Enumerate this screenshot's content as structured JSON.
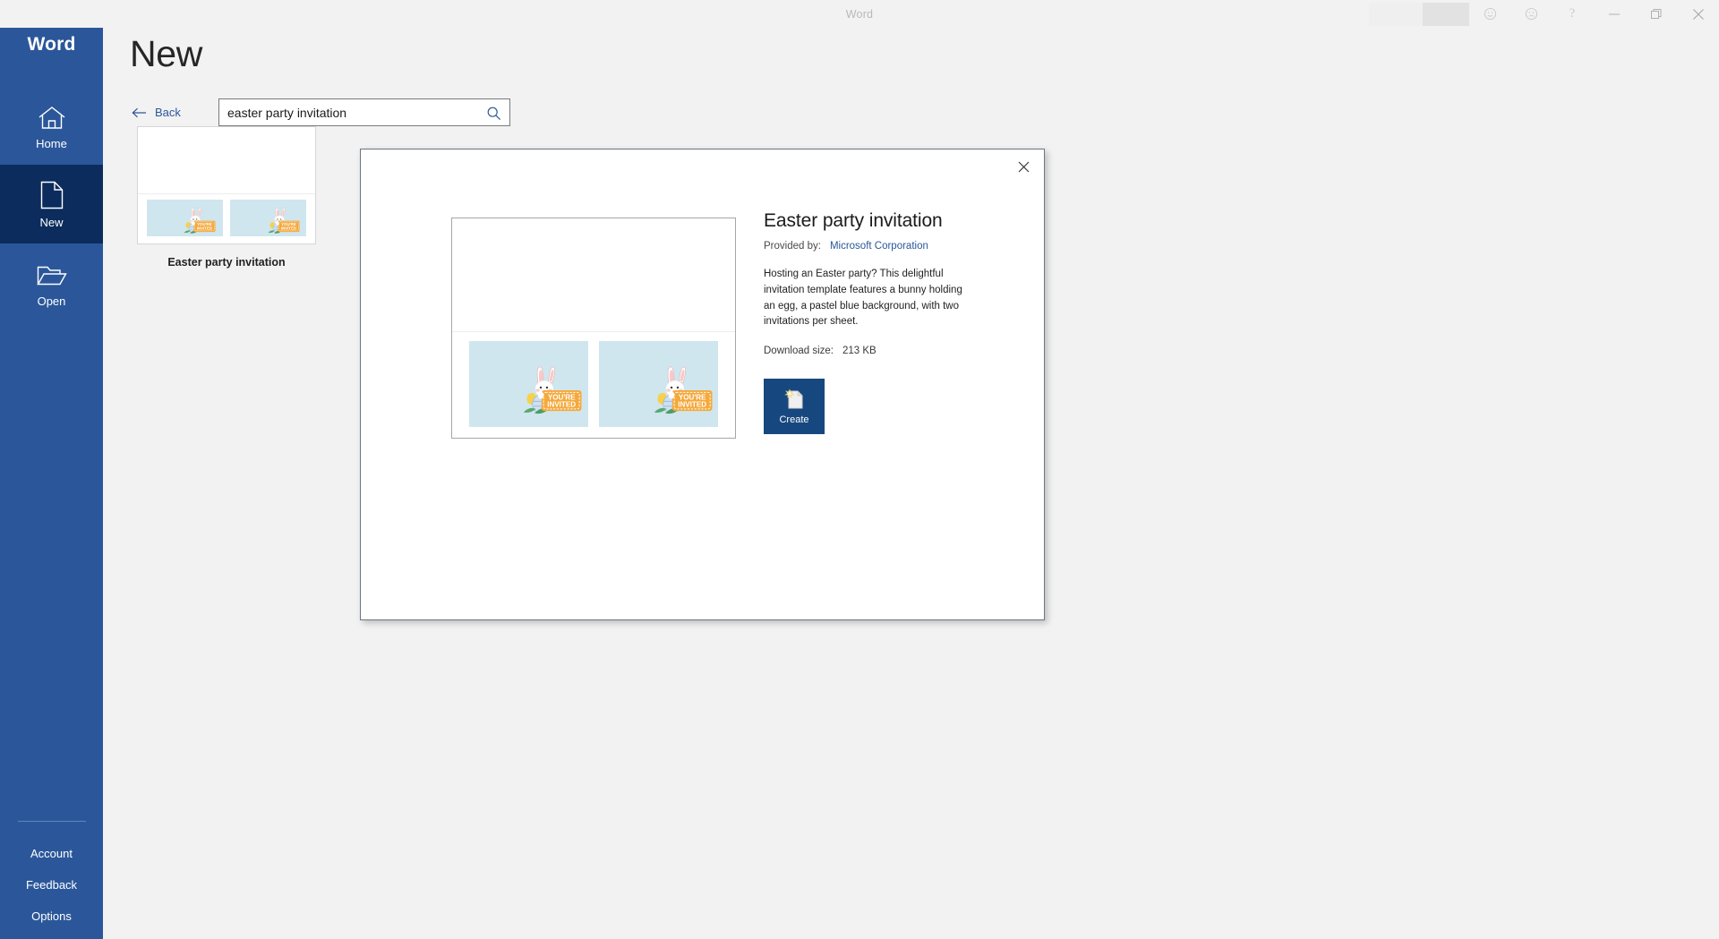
{
  "window": {
    "title": "Word",
    "controls": {
      "smile_icon": "smiley-face-icon",
      "frown_icon": "frowning-face-icon",
      "help_label": "?",
      "minimize_label": "minimize-icon",
      "restore_label": "restore-icon",
      "close_label": "close-icon"
    }
  },
  "sidebar": {
    "brand": "Word",
    "items": [
      {
        "label": "Home",
        "icon": "home-icon",
        "selected": false
      },
      {
        "label": "New",
        "icon": "new-document-icon",
        "selected": true
      },
      {
        "label": "Open",
        "icon": "open-folder-icon",
        "selected": false
      }
    ],
    "bottom_links": [
      {
        "label": "Account"
      },
      {
        "label": "Feedback"
      },
      {
        "label": "Options"
      }
    ]
  },
  "main": {
    "page_title": "New",
    "back_label": "Back",
    "back_icon": "left-arrow-icon",
    "search": {
      "value": "easter party invitation",
      "placeholder": "Search for online templates",
      "icon": "search-icon"
    },
    "results": [
      {
        "caption": "Easter party invitation"
      }
    ]
  },
  "modal": {
    "close_icon": "close-icon",
    "title": "Easter party invitation",
    "provided_by_label": "Provided by:",
    "provided_by_value": "Microsoft Corporation",
    "description": "Hosting an Easter party? This delightful invitation template features a bunny holding an egg, a pastel blue background, with two invitations per sheet.",
    "download_size_label": "Download size:",
    "download_size_value": "213 KB",
    "create_label": "Create",
    "create_icon": "new-document-icon"
  },
  "artwork": {
    "card_text_line1": "YOU'RE",
    "card_text_line2": "INVITED"
  },
  "colors": {
    "brand_blue": "#2b579a",
    "selected_navy": "#0b2c5c",
    "accent_link": "#2b579a",
    "create_button": "#17477f",
    "card_blue": "#cfe6ee",
    "tag_orange": "#f5a93c",
    "page_bg": "#f2f2f2"
  }
}
